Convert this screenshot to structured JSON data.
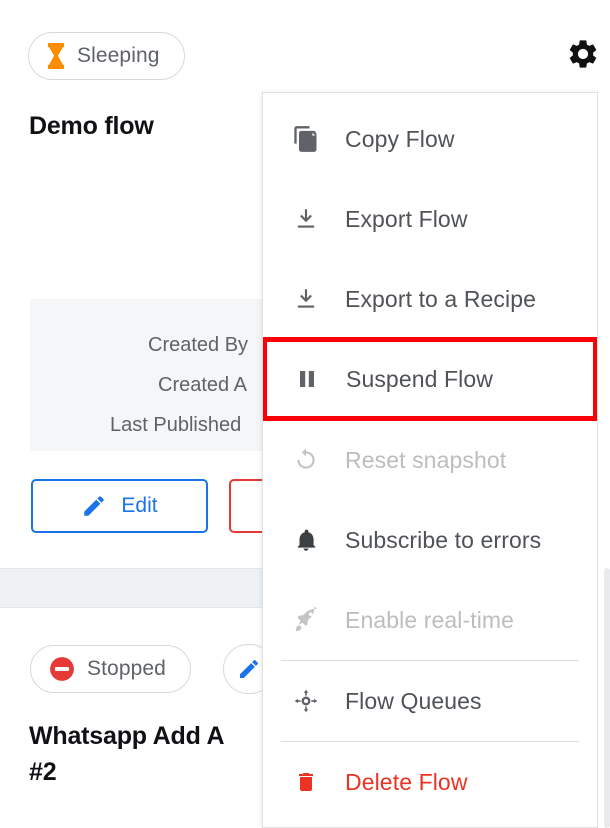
{
  "flows": [
    {
      "status_label": "Sleeping",
      "status_icon": "hourglass-icon",
      "status_color": "#fb8c00",
      "title": "Demo flow",
      "meta": [
        {
          "label": "Created By"
        },
        {
          "label": "Created A"
        },
        {
          "label": "Last Published"
        }
      ],
      "buttons": [
        {
          "label": "Edit",
          "icon": "pencil-icon",
          "color": "#1a73e8"
        },
        {
          "label": "",
          "icon": "",
          "color": "#e53935"
        }
      ]
    },
    {
      "status_label": "Stopped",
      "status_icon": "stop-circle-icon",
      "status_color": "#e53935",
      "title": "Whatsapp Add A\n#2"
    }
  ],
  "gear": {
    "icon": "gear-icon",
    "label": "Settings"
  },
  "menu": {
    "items": [
      {
        "id": "copy-flow",
        "label": "Copy Flow",
        "icon": "copy-icon",
        "state": "enabled",
        "divider_after": false
      },
      {
        "id": "export-flow",
        "label": "Export Flow",
        "icon": "download-icon",
        "state": "enabled",
        "divider_after": false
      },
      {
        "id": "export-recipe",
        "label": "Export to a Recipe",
        "icon": "download-icon",
        "state": "enabled",
        "divider_after": false
      },
      {
        "id": "suspend-flow",
        "label": "Suspend Flow",
        "icon": "pause-icon",
        "state": "highlighted",
        "divider_after": true
      },
      {
        "id": "reset-snapshot",
        "label": "Reset snapshot",
        "icon": "refresh-icon",
        "state": "disabled",
        "divider_after": false
      },
      {
        "id": "subscribe-errors",
        "label": "Subscribe to errors",
        "icon": "bell-icon",
        "state": "enabled",
        "divider_after": false
      },
      {
        "id": "enable-realtime",
        "label": "Enable real-time",
        "icon": "rocket-icon",
        "state": "disabled",
        "divider_after": true
      },
      {
        "id": "flow-queues",
        "label": "Flow Queues",
        "icon": "hub-icon",
        "state": "enabled",
        "divider_after": true
      },
      {
        "id": "delete-flow",
        "label": "Delete Flow",
        "icon": "trash-icon",
        "state": "danger",
        "divider_after": false
      }
    ],
    "highlight_color": "#fb0007",
    "danger_color": "#ea3323",
    "disabled_color": "#bdbdbd",
    "text_color": "#4f5257"
  }
}
